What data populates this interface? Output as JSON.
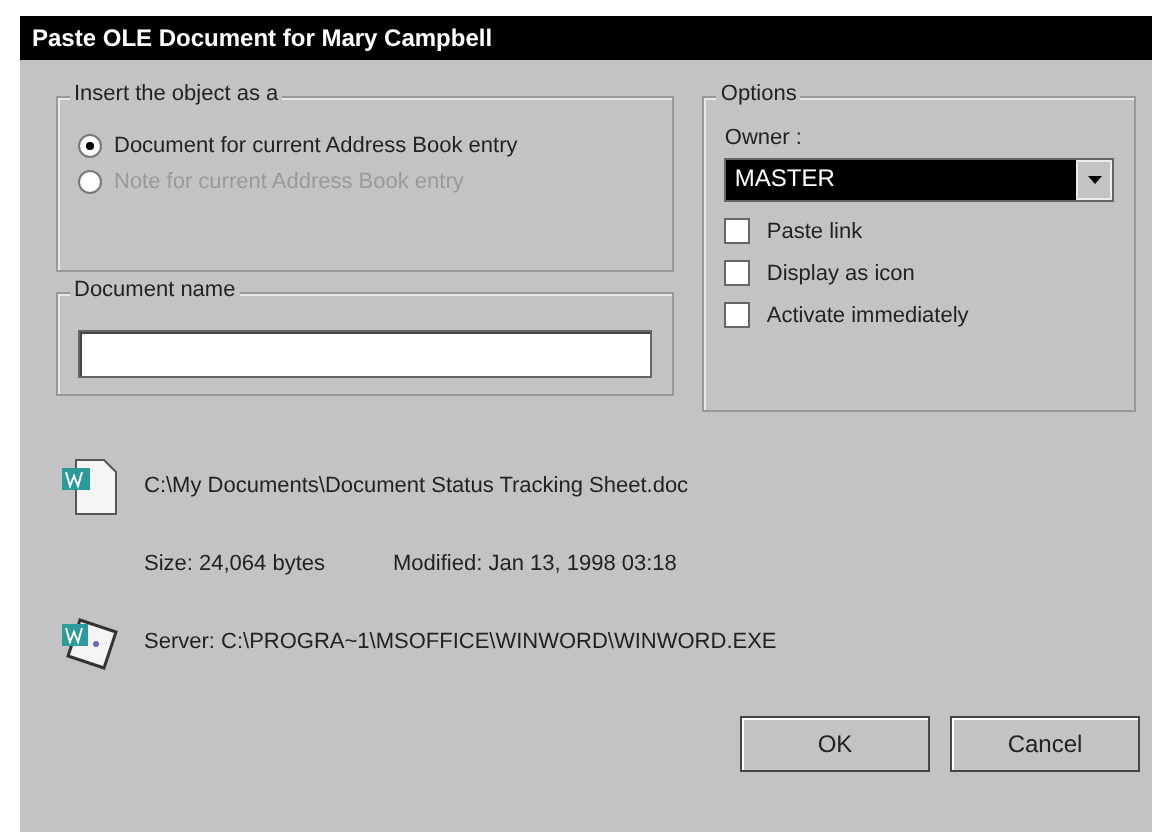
{
  "window": {
    "title": "Paste OLE Document for Mary Campbell"
  },
  "insert_as": {
    "label": "Insert the object as a",
    "options": [
      {
        "label": "Document for current Address Book entry",
        "selected": true,
        "disabled": false
      },
      {
        "label": "Note for current Address Book entry",
        "selected": false,
        "disabled": true
      }
    ]
  },
  "document_name": {
    "label": "Document name"
  },
  "options": {
    "label": "Options",
    "owner_label": "Owner :",
    "owner_value": "MASTER",
    "checkboxes": [
      {
        "label": "Paste link",
        "checked": false
      },
      {
        "label": "Display as icon",
        "checked": false
      },
      {
        "label": "Activate immediately",
        "checked": false
      }
    ]
  },
  "file": {
    "path": "C:\\My Documents\\Document Status Tracking Sheet.doc",
    "size": "Size: 24,064 bytes",
    "modified": "Modified: Jan 13, 1998  03:18",
    "server": "Server: C:\\PROGRA~1\\MSOFFICE\\WINWORD\\WINWORD.EXE"
  },
  "buttons": [
    "OK",
    "Cancel"
  ]
}
